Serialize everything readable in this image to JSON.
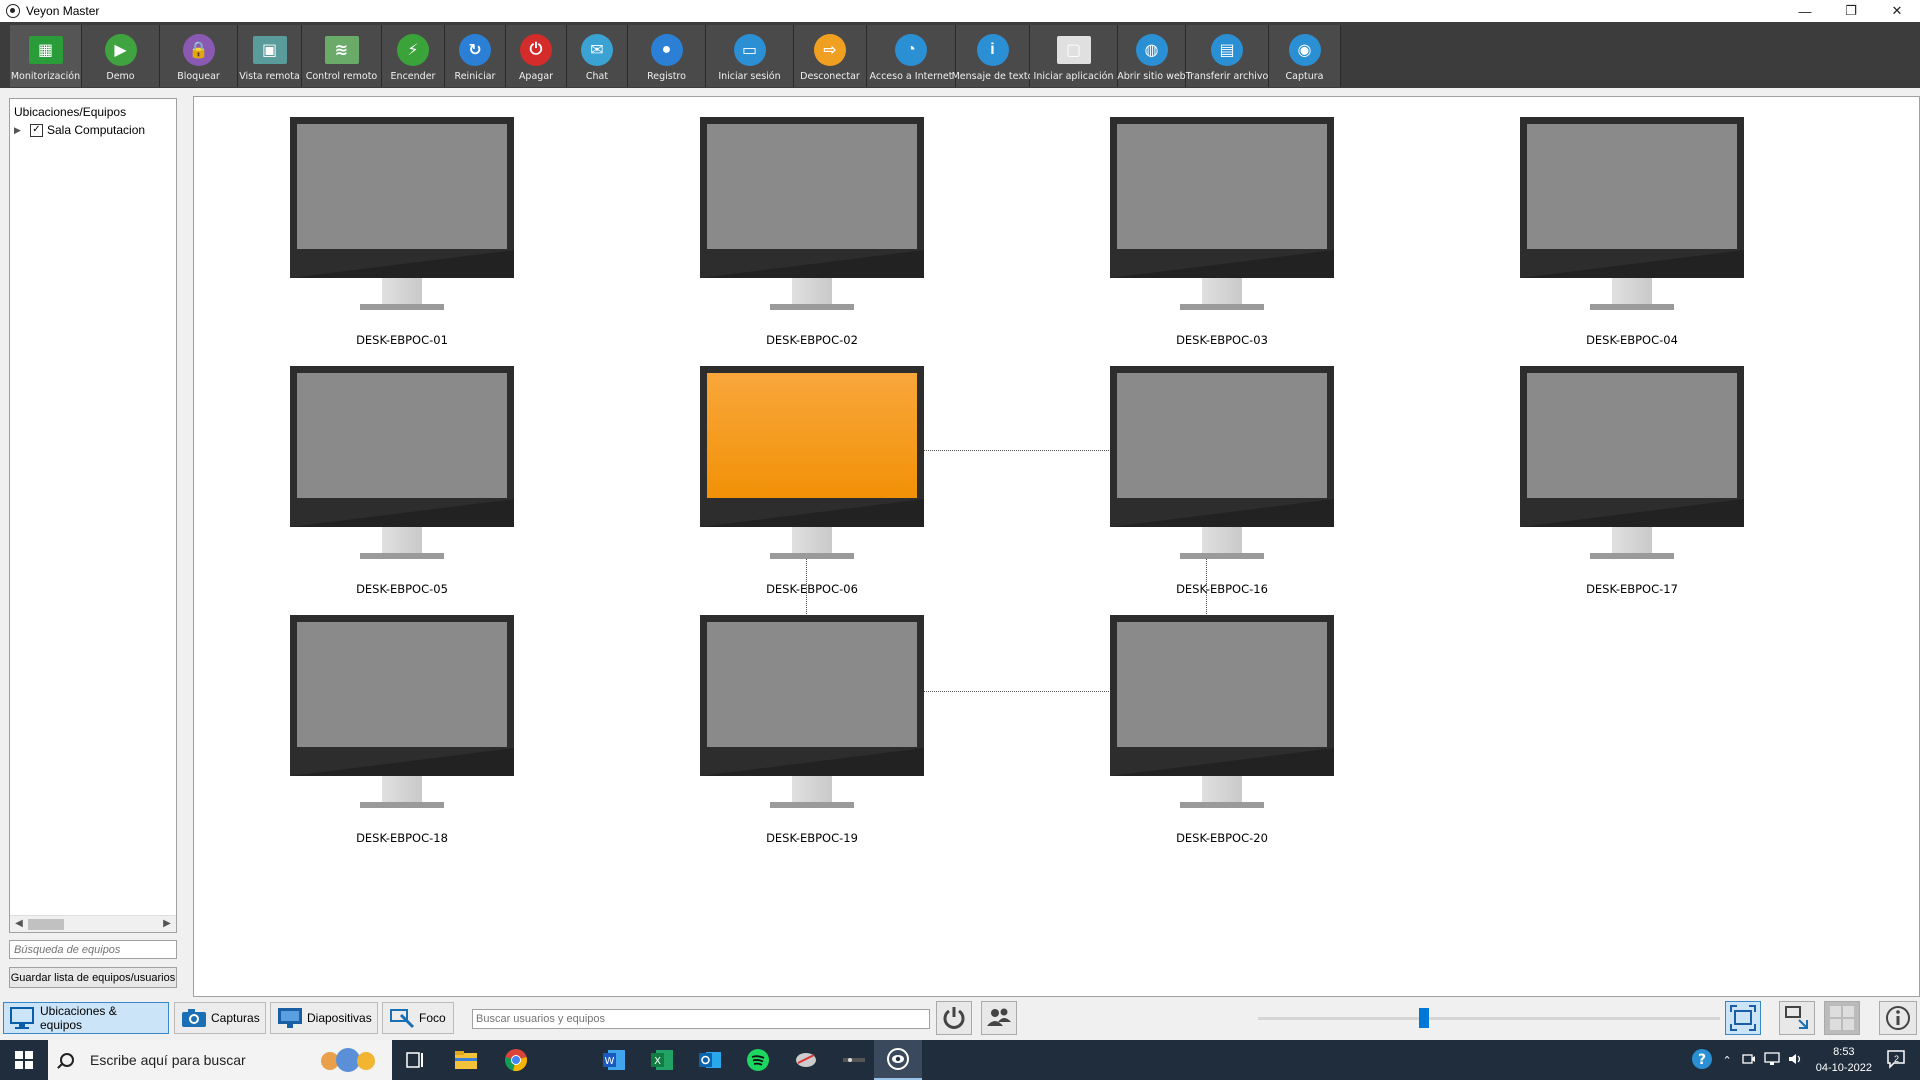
{
  "window": {
    "title": "Veyon Master",
    "minimize": "—",
    "restore": "❐",
    "close": "✕"
  },
  "toolbar": {
    "buttons": [
      {
        "label": "Monitorización",
        "icon": "monitoring-icon",
        "color": "#2a9d3a"
      },
      {
        "label": "Demo",
        "icon": "demo-icon",
        "color": "#3fa33f"
      },
      {
        "label": "Bloquear",
        "icon": "lock-icon",
        "color": "#8a5ab3"
      },
      {
        "label": "Vista remota",
        "icon": "remote-view-icon",
        "color": "#5a9b9b"
      },
      {
        "label": "Control remoto",
        "icon": "remote-control-icon",
        "color": "#6aab6a"
      },
      {
        "label": "Encender",
        "icon": "power-on-icon",
        "color": "#3aa33a"
      },
      {
        "label": "Reiniciar",
        "icon": "reboot-icon",
        "color": "#2b7fd4"
      },
      {
        "label": "Apagar",
        "icon": "power-off-icon",
        "color": "#d42b2b"
      },
      {
        "label": "Chat",
        "icon": "chat-icon",
        "color": "#3aa3d4"
      },
      {
        "label": "Registro",
        "icon": "screen-record-icon",
        "color": "#2b7fd4"
      },
      {
        "label": "Iniciar sesión",
        "icon": "login-icon",
        "color": "#2b8fd4"
      },
      {
        "label": "Desconectar",
        "icon": "logout-icon",
        "color": "#f0a020"
      },
      {
        "label": "Acceso a Internet",
        "icon": "internet-access-icon",
        "color": "#2b8fd4"
      },
      {
        "label": "Mensaje de texto",
        "icon": "text-message-icon",
        "color": "#2b8fd4"
      },
      {
        "label": "Iniciar aplicación",
        "icon": "start-app-icon",
        "color": "#e0e0e0"
      },
      {
        "label": "Abrir sitio web",
        "icon": "website-icon",
        "color": "#2b8fd4"
      },
      {
        "label": "Transferir archivo",
        "icon": "file-transfer-icon",
        "color": "#2b8fd4"
      },
      {
        "label": "Captura",
        "icon": "screenshot-icon",
        "color": "#2b8fd4"
      }
    ]
  },
  "left_panel": {
    "tree_header": "Ubicaciones/Equipos",
    "tree_item": "Sala Computacion",
    "search_placeholder": "Búsqueda de equipos",
    "save_button": "Guardar lista de equipos/usuarios"
  },
  "computers": [
    {
      "name": "DESK-EBPOC-01",
      "state": "off"
    },
    {
      "name": "DESK-EBPOC-02",
      "state": "off"
    },
    {
      "name": "DESK-EBPOC-03",
      "state": "off"
    },
    {
      "name": "DESK-EBPOC-04",
      "state": "off"
    },
    {
      "name": "DESK-EBPOC-05",
      "state": "off"
    },
    {
      "name": "DESK-EBPOC-06",
      "state": "selected"
    },
    {
      "name": "DESK-EBPOC-16",
      "state": "off"
    },
    {
      "name": "DESK-EBPOC-17",
      "state": "off"
    },
    {
      "name": "DESK-EBPOC-18",
      "state": "off"
    },
    {
      "name": "DESK-EBPOC-19",
      "state": "off"
    },
    {
      "name": "DESK-EBPOC-20",
      "state": "off"
    }
  ],
  "bottom_bar": {
    "tab_locations": "Ubicaciones & equipos",
    "tab_captures": "Capturas",
    "tab_slides": "Diapositivas",
    "tab_focus": "Foco",
    "search_placeholder": "Buscar usuarios y equipos",
    "zoom_level": 0.36
  },
  "taskbar": {
    "search_text": "Escribe aquí para buscar",
    "time": "8:53",
    "date": "04-10-2022",
    "notifications": "2"
  }
}
